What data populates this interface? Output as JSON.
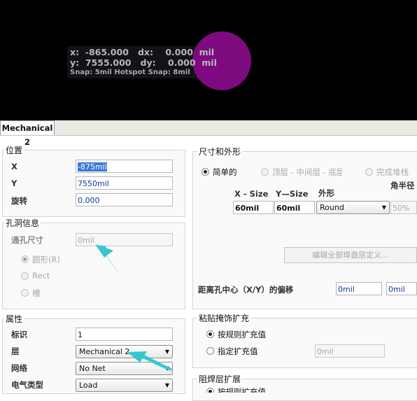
{
  "canvas": {
    "readout_line1": "x:  -865.000   dx:    0.000  mil",
    "readout_line2": "y:  7555.000   dy:    0.000  mil",
    "snap_line": "Snap: 5mil Hotspot Snap: 8mil",
    "pad_color": "#7e0a80"
  },
  "tab": {
    "label": "Mechanical 2"
  },
  "position": {
    "title": "位置",
    "x_label": "X",
    "x_value": "-875mil",
    "y_label": "Y",
    "y_value": "7550mil",
    "rot_label": "旋转",
    "rot_value": "0.000"
  },
  "hole": {
    "title": "孔洞信息",
    "size_label": "通孔尺寸",
    "size_value": "0mil",
    "shape_round": "圆形(R)",
    "shape_rect": "Rect",
    "shape_slot": "槽"
  },
  "props": {
    "title": "属性",
    "designator_label": "标识",
    "designator_value": "1",
    "layer_label": "层",
    "layer_value": "Mechanical 2",
    "net_label": "网络",
    "net_value": "No Net",
    "etype_label": "电气类型",
    "etype_value": "Load"
  },
  "size_shape": {
    "title": "尺寸和外形",
    "opt_simple": "简单的",
    "opt_top_mid": "顶层 - 中间层 - 底层",
    "opt_full": "完成堆栈",
    "corner_label": "角半径",
    "col_xsize": "X - Size",
    "col_ysize": "Y—Size",
    "col_shape": "外形",
    "xsize": "60mil",
    "ysize": "60mil",
    "shape": "Round",
    "corner": "50%",
    "edit_btn": "编辑全部焊盘层定义...",
    "offset_label": "距离孔中心（X/Y）的偏移",
    "offset_x": "0mil",
    "offset_y": "0mil"
  },
  "paste": {
    "title": "粘贴掩饰扩充",
    "opt_rule": "按规则扩充值",
    "opt_specify": "指定扩充值",
    "value": "0mil"
  },
  "solder": {
    "title": "阻焊层扩展",
    "opt_rule": "按规则扩充值"
  },
  "annotation_color": "#34c8d0"
}
